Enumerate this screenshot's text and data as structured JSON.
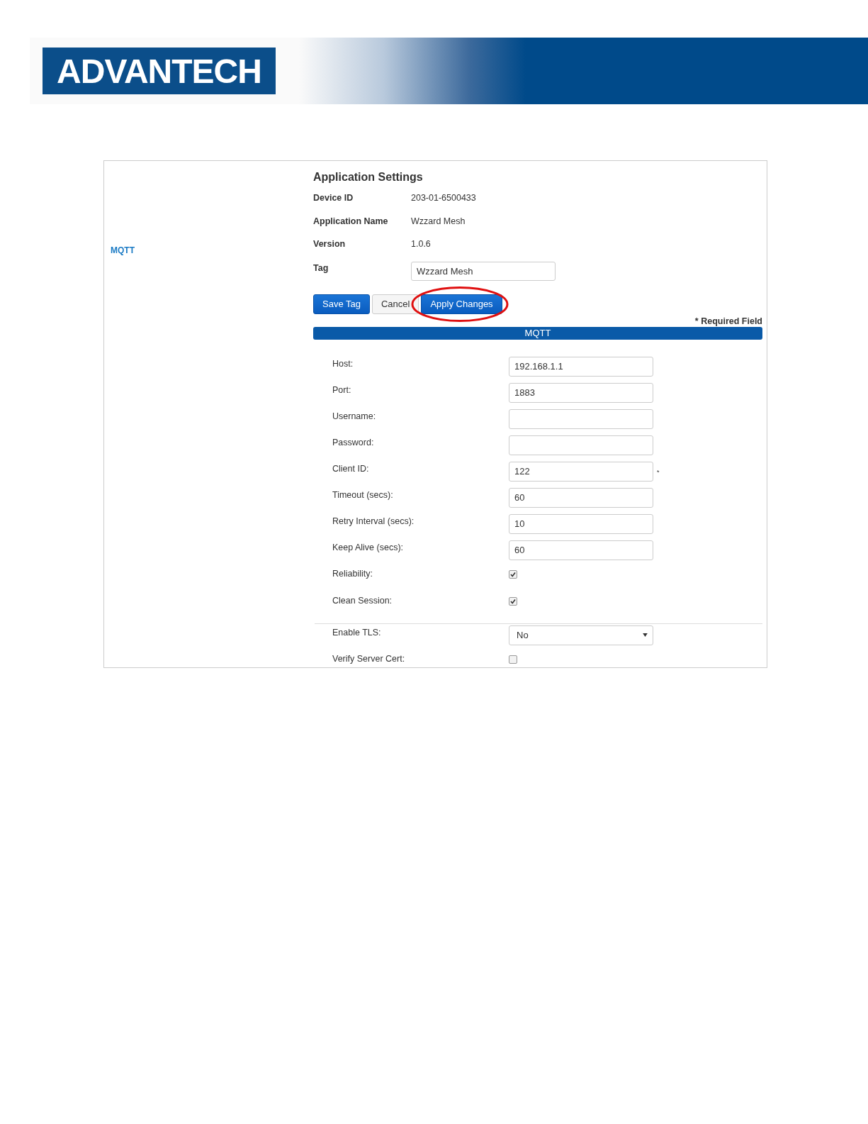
{
  "header": {
    "logo": "ADVANTECH"
  },
  "sidebar": {
    "items": [
      {
        "label": "MQTT",
        "selected": true
      }
    ]
  },
  "app_settings": {
    "title": "Application Settings",
    "info": [
      {
        "label": "Device ID",
        "value": "203-01-6500433"
      },
      {
        "label": "Application Name",
        "value": "Wzzard Mesh"
      },
      {
        "label": "Version",
        "value": "1.0.6"
      }
    ],
    "tag": {
      "label": "Tag",
      "value": "Wzzard Mesh"
    },
    "buttons": [
      {
        "label": "Save Tag",
        "kind": "primary",
        "highlighted": false
      },
      {
        "label": "Cancel",
        "kind": "default",
        "highlighted": false
      },
      {
        "label": "Apply Changes",
        "kind": "primary",
        "highlighted": true
      }
    ],
    "required_note": "* Required Field"
  },
  "section": {
    "title": "MQTT",
    "fields": [
      {
        "label": "Host:",
        "kind": "text",
        "value": "192.168.1.1"
      },
      {
        "label": "Port:",
        "kind": "text",
        "value": "1883"
      },
      {
        "label": "Username:",
        "kind": "text"
      },
      {
        "label": "Password:",
        "kind": "text"
      },
      {
        "label": "Client ID:",
        "kind": "text",
        "value": "122",
        "required_mark": "*"
      },
      {
        "label": "Timeout (secs):",
        "kind": "text",
        "value": "60"
      },
      {
        "label": "Retry Interval (secs):",
        "kind": "text",
        "value": "10"
      },
      {
        "label": "Keep Alive (secs):",
        "kind": "text",
        "value": "60"
      },
      {
        "label": "Reliability:",
        "kind": "checkbox",
        "checked": true
      },
      {
        "label": "Clean Session:",
        "kind": "checkbox",
        "checked": true
      },
      {
        "label": "Enable TLS:",
        "kind": "select",
        "value": "No",
        "divider_before": true
      },
      {
        "label": "Verify Server Cert:",
        "kind": "checkbox",
        "checked": false
      }
    ]
  }
}
